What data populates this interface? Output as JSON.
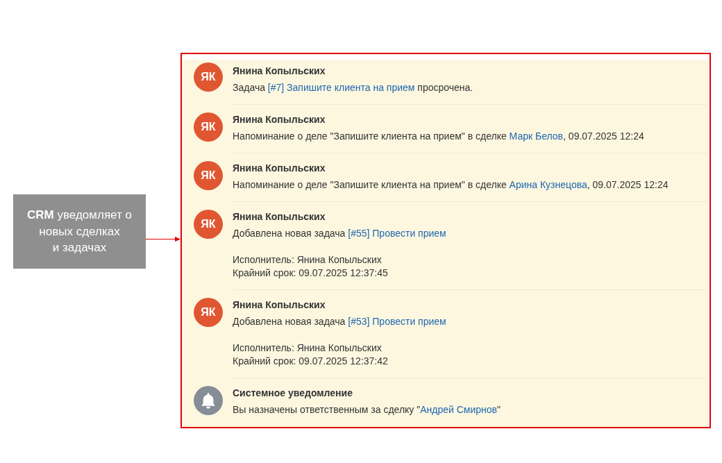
{
  "callout": {
    "text": "**CRM** уведомляет о\nновых сделках\nи задачах"
  },
  "notifications": [
    {
      "kind": "user",
      "initials": "ЯК",
      "author": "Янина Копыльских",
      "message": [
        {
          "kind": "text",
          "text": "Задача "
        },
        {
          "kind": "link",
          "text": "[#7] Запишите клиента на прием"
        },
        {
          "kind": "text",
          "text": " просрочена."
        }
      ]
    },
    {
      "kind": "user",
      "initials": "ЯК",
      "author": "Янина Копыльских",
      "message": [
        {
          "kind": "text",
          "text": "Напоминание о деле \"Запишите клиента на прием\" в сделке "
        },
        {
          "kind": "link",
          "text": "Марк Белов"
        },
        {
          "kind": "text",
          "text": ", 09.07.2025 12:24"
        }
      ]
    },
    {
      "kind": "user",
      "initials": "ЯК",
      "author": "Янина Копыльских",
      "message": [
        {
          "kind": "text",
          "text": "Напоминание о деле \"Запишите клиента на прием\" в сделке "
        },
        {
          "kind": "link",
          "text": "Арина Кузнецова"
        },
        {
          "kind": "text",
          "text": ", 09.07.2025 12:24"
        }
      ]
    },
    {
      "kind": "user",
      "initials": "ЯК",
      "author": "Янина Копыльских",
      "message": [
        {
          "kind": "text",
          "text": "Добавлена новая задача "
        },
        {
          "kind": "link",
          "text": "[#55] Провести прием"
        }
      ],
      "details": [
        "Исполнитель: Янина Копыльских",
        "Крайний срок: 09.07.2025 12:37:45"
      ]
    },
    {
      "kind": "user",
      "initials": "ЯК",
      "author": "Янина Копыльских",
      "message": [
        {
          "kind": "text",
          "text": "Добавлена новая задача "
        },
        {
          "kind": "link",
          "text": "[#53] Провести прием"
        }
      ],
      "details": [
        "Исполнитель: Янина Копыльских",
        "Крайний срок: 09.07.2025 12:37:42"
      ]
    },
    {
      "kind": "system",
      "author": "Системное уведомление",
      "message": [
        {
          "kind": "text",
          "text": "Вы назначены ответственным за сделку \""
        },
        {
          "kind": "link",
          "text": "Андрей Смирнов"
        },
        {
          "kind": "text",
          "text": "\""
        }
      ]
    }
  ]
}
